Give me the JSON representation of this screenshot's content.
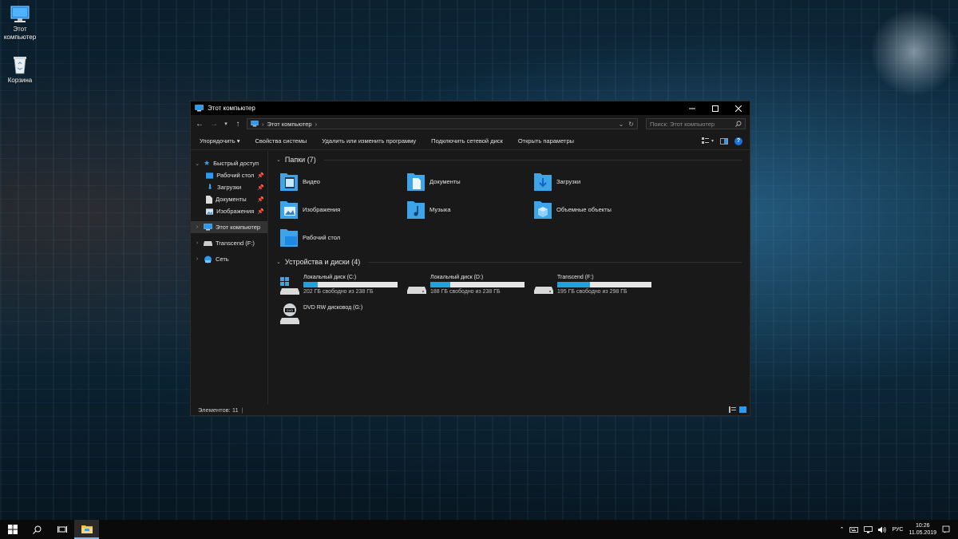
{
  "desktop": {
    "icons": [
      {
        "label": "Этот компьютер",
        "icon": "computer-icon"
      },
      {
        "label": "Корзина",
        "icon": "recycle-bin-icon"
      }
    ]
  },
  "window": {
    "title": "Этот компьютер",
    "address": {
      "path": "Этот компьютер"
    },
    "search": {
      "placeholder": "Поиск: Этот компьютер"
    },
    "commands": [
      "Упорядочить",
      "Свойства системы",
      "Удалить или изменить программу",
      "Подключить сетевой диск",
      "Открыть параметры"
    ],
    "organize_label": "Упорядочить ▾",
    "nav": {
      "quick_access": "Быстрый доступ",
      "quick_items": [
        "Рабочий стол",
        "Загрузки",
        "Документы",
        "Изображения"
      ],
      "this_pc": "Этот компьютер",
      "transcend": "Transcend (F:)",
      "network": "Сеть"
    },
    "folders_header": "Папки (7)",
    "folders": [
      "Видео",
      "Документы",
      "Загрузки",
      "Изображения",
      "Музыка",
      "Объемные объекты",
      "Рабочий стол"
    ],
    "drives_header": "Устройства и диски (4)",
    "drives": [
      {
        "name": "Локальный диск (C:)",
        "free": "202 ГБ свободно из 238 ГБ",
        "used_fraction": 0.15
      },
      {
        "name": "Локальный диск (D:)",
        "free": "188 ГБ свободно из 238 ГБ",
        "used_fraction": 0.21
      },
      {
        "name": "Transcend (F:)",
        "free": "195 ГБ свободно из 298 ГБ",
        "used_fraction": 0.35
      }
    ],
    "dvd": {
      "name": "DVD RW дисковод (G:)",
      "badge": "DVD"
    },
    "status": "Элементов: 11"
  },
  "taskbar": {
    "lang": "РУС",
    "time": "10:26",
    "date": "11.05.2019"
  },
  "colors": {
    "accent": "#26a0da",
    "folder": "#3fa3e8",
    "titlebar": "#000000",
    "window_bg": "#191919"
  }
}
